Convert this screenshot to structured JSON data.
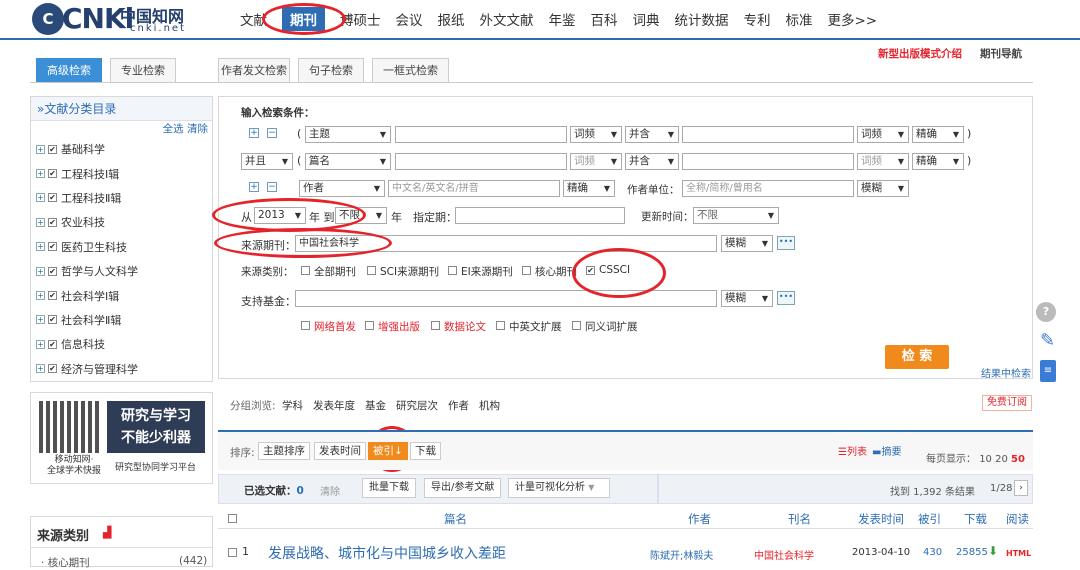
{
  "logo": {
    "chars": "中国知网",
    "sub": "cnki.net",
    "mark": "CNKi"
  },
  "nav": [
    "文献",
    "期刊",
    "博硕士",
    "会议",
    "报纸",
    "外文文献",
    "年鉴",
    "百科",
    "词典",
    "统计数据",
    "专利",
    "标准",
    "更多>>"
  ],
  "toplinks": {
    "new_mode": "新型出版模式介绍",
    "journal_nav": "期刊导航"
  },
  "tabs": [
    "高级检索",
    "专业检索",
    "作者发文检索",
    "句子检索",
    "一框式检索"
  ],
  "sidebar": {
    "title": "»文献分类目录",
    "select_all": "全选",
    "clear": "清除",
    "items": [
      "基础科学",
      "工程科技Ⅰ辑",
      "工程科技Ⅱ辑",
      "农业科技",
      "医药卫生科技",
      "哲学与人文科学",
      "社会科学Ⅰ辑",
      "社会科学Ⅱ辑",
      "信息科技",
      "经济与管理科学"
    ]
  },
  "search": {
    "label": "输入检索条件：",
    "row1": {
      "paren": "(",
      "field": "主题",
      "freq": "词频",
      "op": "并含",
      "freq2": "词频",
      "match": "精确",
      "close": ")"
    },
    "row2": {
      "logic": "并且",
      "paren": "(",
      "field": "篇名",
      "freq": "词频",
      "op": "并含",
      "freq2": "词频",
      "match": "精确",
      "close": ")"
    },
    "row3": {
      "field": "作者",
      "placeholder": "中文名/英文名/拼音",
      "match": "精确",
      "unit_label": "作者单位：",
      "unit_placeholder": "全称/简称/曾用名",
      "unit_match": "模糊"
    },
    "date": {
      "from": "从",
      "from_year": "2013",
      "to": "年 到",
      "to_year": "不限",
      "year": "年",
      "specify": "指定期：",
      "update_label": "更新时间：",
      "update_value": "不限"
    },
    "source": {
      "label": "来源期刊：",
      "value": "中国社会科学",
      "match": "模糊",
      "dots": "•••"
    },
    "category": {
      "label": "来源类别：",
      "options": [
        "全部期刊",
        "SCI来源期刊",
        "EI来源期刊",
        "核心期刊",
        "CSSCI"
      ]
    },
    "fund": {
      "label": "支持基金：",
      "match": "模糊",
      "dots": "•••"
    },
    "extras": [
      "网络首发",
      "增强出版",
      "数据论文",
      "中英文扩展",
      "同义词扩展"
    ],
    "submit": "检 索",
    "in_results": "结果中检索"
  },
  "ad": {
    "line1": "研究与学习",
    "line2": "不能少利器",
    "cap1": "移动知网·",
    "cap2": "全球学术快报",
    "cap3": "研究型协同学习平台"
  },
  "source_box": {
    "title": "来源类别",
    "item": "核心期刊",
    "count": "(442)"
  },
  "group": {
    "label": "分组浏览:",
    "items": [
      "学科",
      "发表年度",
      "基金",
      "研究层次",
      "作者",
      "机构"
    ],
    "free": "免费订阅"
  },
  "sort": {
    "label": "排序:",
    "items": [
      "主题排序",
      "发表时间",
      "被引↓",
      "下载"
    ],
    "view_list": "列表",
    "view_abs": "摘要",
    "per_page_label": "每页显示：",
    "per_page": [
      "10",
      "20",
      "50"
    ]
  },
  "toolbar": {
    "selected_label": "已选文献：",
    "selected_count": "0",
    "clear": "清除",
    "batch": "批量下载",
    "export": "导出/参考文献",
    "viz": "计量可视化分析",
    "found": "找到 1,392 条结果",
    "page": "1/28"
  },
  "table": {
    "headers": [
      "篇名",
      "作者",
      "刊名",
      "发表时间",
      "被引",
      "下载",
      "阅读"
    ],
    "rows": [
      {
        "num": "1",
        "title": "发展战略、城市化与中国城乡收入差距",
        "author": "陈斌开;林毅夫",
        "journal": "中国社会科学",
        "date": "2013-04-10",
        "cited": "430",
        "downloads": "25855",
        "read": "HTML"
      }
    ]
  },
  "colors": {
    "accent": "#2e6db4",
    "highlight": "#e5232b",
    "orange": "#f08a1c"
  },
  "side_icons": [
    "help-icon",
    "pen-icon",
    "notes-icon"
  ]
}
